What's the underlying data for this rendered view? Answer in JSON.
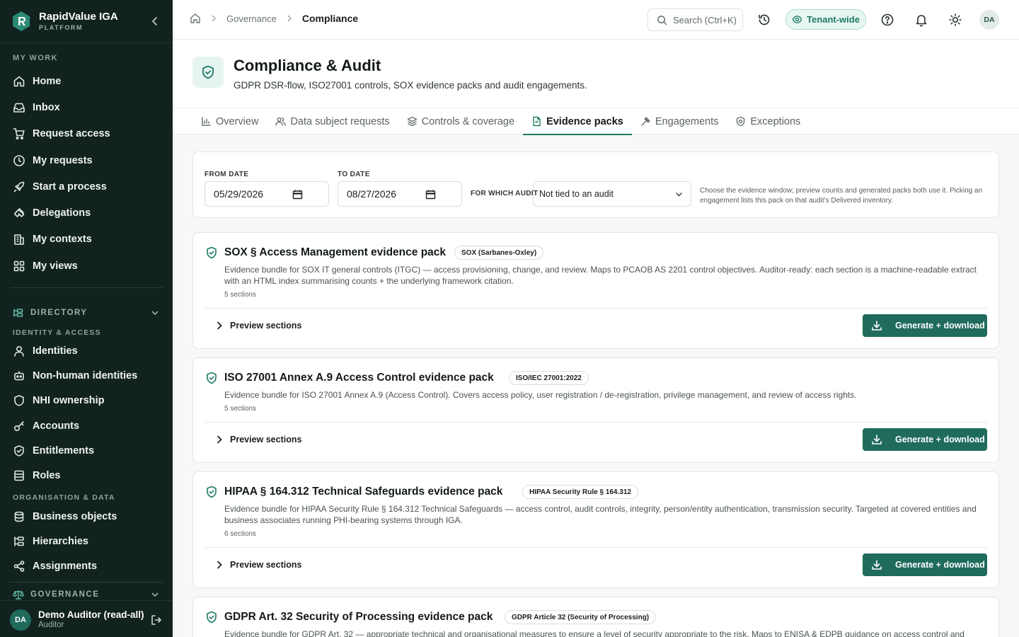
{
  "brand": {
    "name": "RapidValue IGA",
    "subtitle": "PLATFORM"
  },
  "sidebar": {
    "my_work_label": "MY WORK",
    "items": [
      {
        "label": "Home",
        "icon": "home-icon"
      },
      {
        "label": "Inbox",
        "icon": "inbox-icon"
      },
      {
        "label": "Request access",
        "icon": "cart-icon"
      },
      {
        "label": "My requests",
        "icon": "clock-icon"
      },
      {
        "label": "Start a process",
        "icon": "rocket-icon"
      },
      {
        "label": "Delegations",
        "icon": "delegation-icon"
      },
      {
        "label": "My contexts",
        "icon": "building-icon"
      },
      {
        "label": "My views",
        "icon": "grid-icon"
      }
    ],
    "directory_label": "DIRECTORY",
    "identity_access_label": "IDENTITY & ACCESS",
    "identity_items": [
      {
        "label": "Identities",
        "icon": "person-icon"
      },
      {
        "label": "Non-human identities",
        "icon": "bot-icon"
      },
      {
        "label": "NHI ownership",
        "icon": "shield-icon"
      },
      {
        "label": "Accounts",
        "icon": "key-icon"
      },
      {
        "label": "Entitlements",
        "icon": "shield-check-icon"
      },
      {
        "label": "Roles",
        "icon": "layers-icon"
      }
    ],
    "org_data_label": "ORGANISATION & DATA",
    "org_items": [
      {
        "label": "Business objects",
        "icon": "database-icon"
      },
      {
        "label": "Hierarchies",
        "icon": "hierarchy-icon"
      },
      {
        "label": "Assignments",
        "icon": "share-icon"
      }
    ],
    "governance_label": "GOVERNANCE",
    "user": {
      "initials": "DA",
      "name": "Demo Auditor (read-all)",
      "role": "Auditor"
    }
  },
  "topbar": {
    "breadcrumbs": [
      "Governance",
      "Compliance"
    ],
    "search_label": "Search (Ctrl+K)",
    "tenant_label": "Tenant-wide",
    "avatar_initials": "DA"
  },
  "page": {
    "title": "Compliance & Audit",
    "subtitle": "GDPR DSR-flow, ISO27001 controls, SOX evidence packs and audit engagements.",
    "tabs": [
      {
        "label": "Overview",
        "icon": "chart-icon"
      },
      {
        "label": "Data subject requests",
        "icon": "users-icon"
      },
      {
        "label": "Controls & coverage",
        "icon": "stack-icon"
      },
      {
        "label": "Evidence packs",
        "icon": "file-icon",
        "active": true
      },
      {
        "label": "Engagements",
        "icon": "gavel-icon"
      },
      {
        "label": "Exceptions",
        "icon": "shield-x-icon"
      }
    ]
  },
  "filters": {
    "from_label": "FROM DATE",
    "from_value": "05/29/2026",
    "to_label": "TO DATE",
    "to_value": "08/27/2026",
    "audit_label": "FOR WHICH AUDIT",
    "audit_value": "Not tied to an audit",
    "help": "Choose the evidence window; preview counts and generated packs both use it. Picking an engagement lists this pack on that audit's Delivered inventory."
  },
  "packs": [
    {
      "title": "SOX § Access Management evidence pack",
      "badge": "SOX (Sarbanes-Oxley)",
      "description": "Evidence bundle for SOX IT general controls (ITGC) — access provisioning, change, and review. Maps to PCAOB AS 2201 control objectives. Auditor-ready: each section is a machine-readable extract with an HTML index summarising counts + the underlying framework citation.",
      "sections": "5 sections",
      "preview_label": "Preview sections",
      "button_label": "Generate + download"
    },
    {
      "title": "ISO 27001 Annex A.9 Access Control evidence pack",
      "badge": "ISO/IEC 27001:2022",
      "description": "Evidence bundle for ISO 27001 Annex A.9 (Access Control). Covers access policy, user registration / de-registration, privilege management, and review of access rights.",
      "sections": "5 sections",
      "preview_label": "Preview sections",
      "button_label": "Generate + download"
    },
    {
      "title": "HIPAA § 164.312 Technical Safeguards evidence pack",
      "badge": "HIPAA Security Rule § 164.312",
      "description": "Evidence bundle for HIPAA Security Rule § 164.312 Technical Safeguards — access control, audit controls, integrity, person/entity authentication, transmission security. Targeted at covered entities and business associates running PHI-bearing systems through IGA.",
      "sections": "6 sections",
      "preview_label": "Preview sections",
      "button_label": "Generate + download"
    },
    {
      "title": "GDPR Art. 32 Security of Processing evidence pack",
      "badge": "GDPR Article 32 (Security of Processing)",
      "description": "Evidence bundle for GDPR Art. 32 — appropriate technical and organisational measures to ensure a level of security appropriate to the risk. Maps to ENISA & EDPB guidance on access control and"
    }
  ],
  "colors": {
    "sidebar_bg": "#12221f",
    "accent": "#1f7a66",
    "button_bg": "#1f6b5c"
  }
}
